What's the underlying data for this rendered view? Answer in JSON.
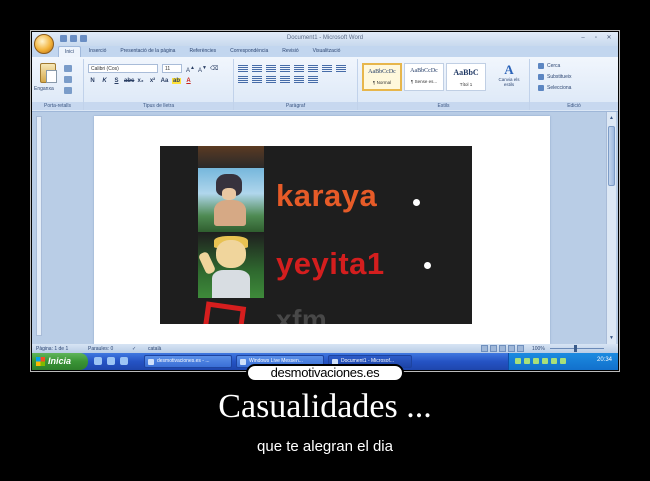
{
  "window": {
    "title": "Document1 - Microsoft Word",
    "controls": [
      "–",
      "▫",
      "✕"
    ]
  },
  "ribbon": {
    "tabs": [
      "Inici",
      "Inserció",
      "Presentació de la pàgina",
      "Referències",
      "Correspondència",
      "Revisió",
      "Visualització"
    ],
    "clipboard": {
      "paste_label": "Enganxa",
      "group_label": "Porta-retalls"
    },
    "font": {
      "font_name": "Calibri (Cos)",
      "font_size": "11",
      "group_label": "Tipus de lletra"
    },
    "paragraph": {
      "group_label": "Paràgraf"
    },
    "styles": {
      "items": [
        {
          "sample": "AaBbCcDc",
          "name": "¶ Normal"
        },
        {
          "sample": "AaBbCcDc",
          "name": "¶ Sense es..."
        },
        {
          "sample": "AaBbC",
          "name": "Títol 1"
        }
      ],
      "change_label": "Canvia els estils",
      "group_label": "Estils"
    },
    "editing": {
      "items": [
        "Cerca",
        "Substitueix",
        "Selecciona"
      ],
      "group_label": "Edició"
    }
  },
  "document": {
    "embedded_names": [
      "karaya",
      "yeyita1",
      "xfm"
    ]
  },
  "statusbar": {
    "page": "Pàgina: 1 de 1",
    "words": "Paraules: 0",
    "language": "català",
    "zoom": "100%"
  },
  "taskbar": {
    "start_label": "Inicia",
    "tasks": [
      "desmotivaciones.es - ...",
      "Windows Live Messen...",
      "Document1 - Microsof..."
    ],
    "clock": "20:34"
  },
  "poster": {
    "logo": "desmotivaciones.es",
    "title": "Casualidades ...",
    "subtitle": "que te alegran el dia"
  }
}
